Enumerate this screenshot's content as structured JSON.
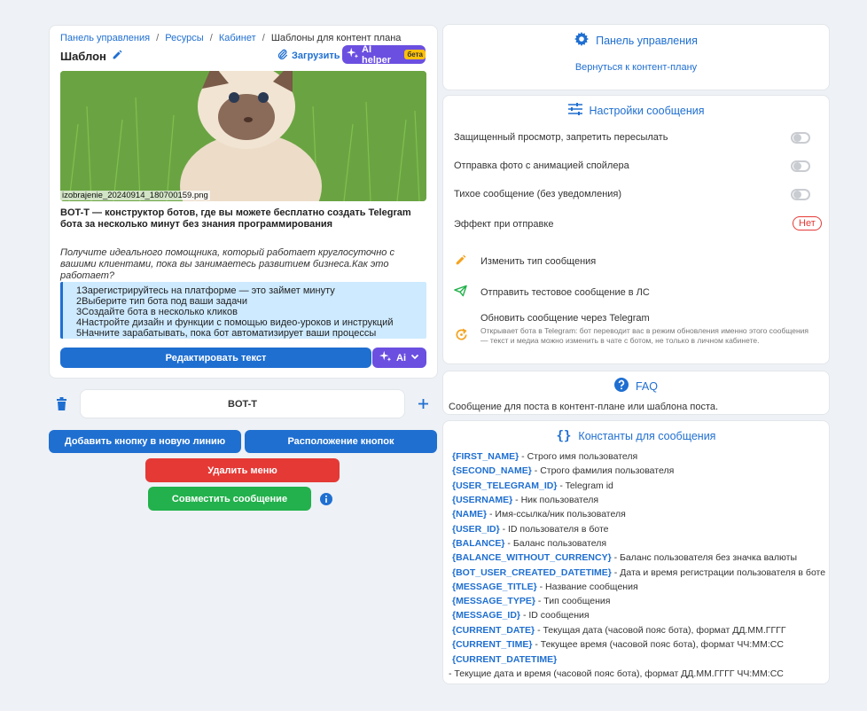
{
  "breadcrumb": {
    "items": [
      "Панель управления",
      "Ресурсы",
      "Кабинет"
    ],
    "sep": "/",
    "current": "Шаблоны для контент плана"
  },
  "editor": {
    "title": "Шаблон",
    "upload_label": "Загрузить",
    "ai_helper_label": "AI helper",
    "beta_label": "бета",
    "image_filename": "izobrajenie_20240914_180700159.png",
    "heading": "BOT-T — конструктор ботов, где вы можете бесплатно создать Telegram бота за несколько минут без знания программирования",
    "italic_text": "Получите идеального помощника, который работает круглосуточно с вашими клиентами, пока вы занимаетесь развитием бизнеса.Как это работает?",
    "steps": [
      "1Зарегистрируйтесь на платформе — это займет минуту",
      "2Выберите тип бота под ваши задачи",
      "3Создайте бота в несколько кликов",
      "4Настройте дизайн и функции с помощью видео-уроков и инструкций",
      "5Начните зарабатывать, пока бот автоматизирует ваши процессы"
    ],
    "edit_text_button": "Редактировать текст",
    "ai_button": "Ai"
  },
  "buttons_block": {
    "inline_button_label": "BOT-T",
    "add_line_button": "Добавить кнопку в новую линию",
    "layout_button": "Расположение кнопок",
    "delete_menu_button": "Удалить меню",
    "combine_button": "Совместить сообщение"
  },
  "control_panel": {
    "title": "Панель управления",
    "back_link": "Вернуться к контент-плану"
  },
  "settings": {
    "title": "Настройки сообщения",
    "toggles": [
      {
        "label": "Защищенный просмотр, запретить пересылать",
        "on": false
      },
      {
        "label": "Отправка фото с анимацией спойлера",
        "on": false
      },
      {
        "label": "Тихое сообщение (без уведомления)",
        "on": false
      }
    ],
    "effect_label": "Эффект при отправке",
    "effect_value": "Нет",
    "actions": {
      "change_type": "Изменить тип сообщения",
      "send_test": "Отправить тестовое сообщение в ЛС",
      "update_title": "Обновить сообщение через Telegram",
      "update_desc": "Открывает бота в Telegram: бот переводит вас в режим обновления именно этого сообщения — текст и медиа можно изменить в чате с ботом, не только в личном кабинете."
    }
  },
  "faq": {
    "title": "FAQ",
    "text": "Сообщение для поста в контент-плане или шаблона поста."
  },
  "constants": {
    "title": "Константы для сообщения",
    "items": [
      {
        "key": "{FIRST_NAME}",
        "desc": " - Строго имя пользователя"
      },
      {
        "key": "{SECOND_NAME}",
        "desc": " - Строго фамилия пользователя"
      },
      {
        "key": "{USER_TELEGRAM_ID}",
        "desc": " - Telegram id"
      },
      {
        "key": "{USERNAME}",
        "desc": " - Ник пользователя"
      },
      {
        "key": "{NAME}",
        "desc": " - Имя-ссылка/ник пользователя"
      },
      {
        "key": "{USER_ID}",
        "desc": " - ID пользователя в боте"
      },
      {
        "key": "{BALANCE}",
        "desc": " - Баланс пользователя"
      },
      {
        "key": "{BALANCE_WITHOUT_CURRENCY}",
        "desc": " - Баланс пользователя без значка валюты"
      },
      {
        "key": "{BOT_USER_CREATED_DATETIME}",
        "desc": " - Дата и время регистрации пользователя в боте"
      },
      {
        "key": "{MESSAGE_TITLE}",
        "desc": " - Название сообщения"
      },
      {
        "key": "{MESSAGE_TYPE}",
        "desc": " - Тип сообщения"
      },
      {
        "key": "{MESSAGE_ID}",
        "desc": " - ID сообщения"
      },
      {
        "key": "{CURRENT_DATE}",
        "desc": " - Текущая дата (часовой пояс бота), формат ДД.ММ.ГГГГ"
      },
      {
        "key": "{CURRENT_TIME}",
        "desc": " - Текущее время (часовой пояс бота), формат ЧЧ:ММ:СС"
      },
      {
        "key": "{CURRENT_DATETIME}",
        "desc": ""
      }
    ],
    "last_desc": "- Текущие дата и время (часовой пояс бота), формат ДД.ММ.ГГГГ ЧЧ:ММ:СС"
  },
  "colors": {
    "accent": "#1f6fd1",
    "danger": "#e53935",
    "success": "#22b14c",
    "ai_purple": "#6b4fe0"
  }
}
